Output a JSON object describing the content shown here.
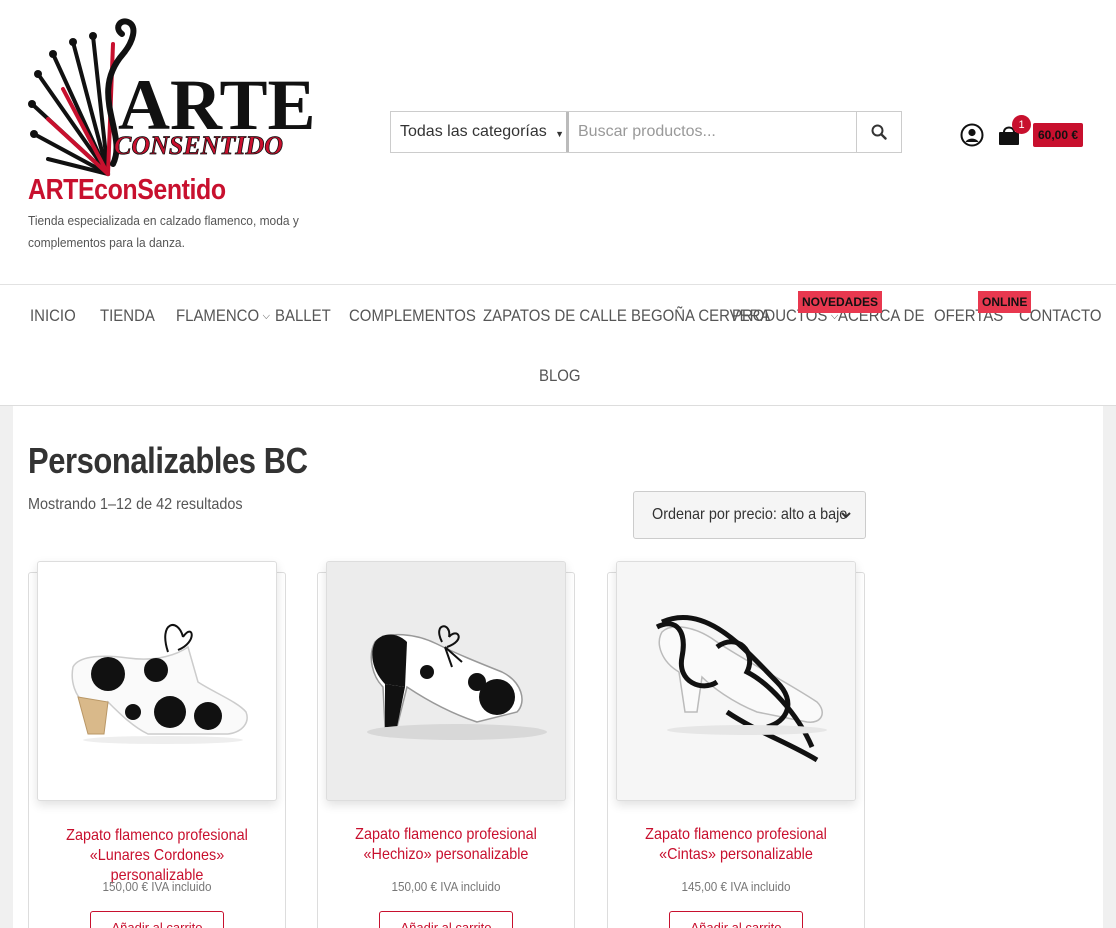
{
  "site": {
    "title": "ARTEconSentido",
    "description": "Tienda especializada en calzado flamenco, moda y complementos para la danza.",
    "logo_text_main": "ARTE",
    "logo_text_sub": "CONSENTIDO"
  },
  "search": {
    "category_label": "Todas las categorías",
    "placeholder": "Buscar productos..."
  },
  "cart": {
    "count": "1",
    "total": "60,00 €"
  },
  "icons": {
    "search": "search-icon",
    "account": "user-circle-icon",
    "cart": "shopping-bag-icon",
    "dropdown": "chevron-down-icon"
  },
  "nav": {
    "items": [
      {
        "label": "INICIO"
      },
      {
        "label": "TIENDA"
      },
      {
        "label": "FLAMENCO"
      },
      {
        "label": "BALLET"
      },
      {
        "label": "COMPLEMENTOS"
      },
      {
        "label": "ZAPATOS DE CALLE BEGOÑA CERVERA"
      },
      {
        "label": "PRODUCTOS"
      },
      {
        "label": "ACERCA DE"
      },
      {
        "label": "OFERTAS"
      },
      {
        "label": "CONTACTO"
      },
      {
        "label": "BLOG"
      }
    ],
    "badges": {
      "productos": "NOVEDADES",
      "ofertas": "ONLINE"
    }
  },
  "main": {
    "title": "Personalizables BC",
    "result_count": "Mostrando 1–12 de 42 resultados",
    "sort_label": "Ordenar por precio: alto a bajo"
  },
  "products": [
    {
      "title": "Zapato flamenco profesional «Lunares Cordones» personalizable",
      "price": "150,00 € IVA incluido",
      "button": "Añadir al carrito"
    },
    {
      "title": "Zapato flamenco profesional «Hechizo» personalizable",
      "price": "150,00 € IVA incluido",
      "button": "Añadir al carrito"
    },
    {
      "title": "Zapato flamenco profesional «Cintas» personalizable",
      "price": "145,00 € IVA incluido",
      "button": "Añadir al carrito"
    }
  ],
  "colors": {
    "brand": "#c8102e",
    "badge": "#e8384f"
  }
}
